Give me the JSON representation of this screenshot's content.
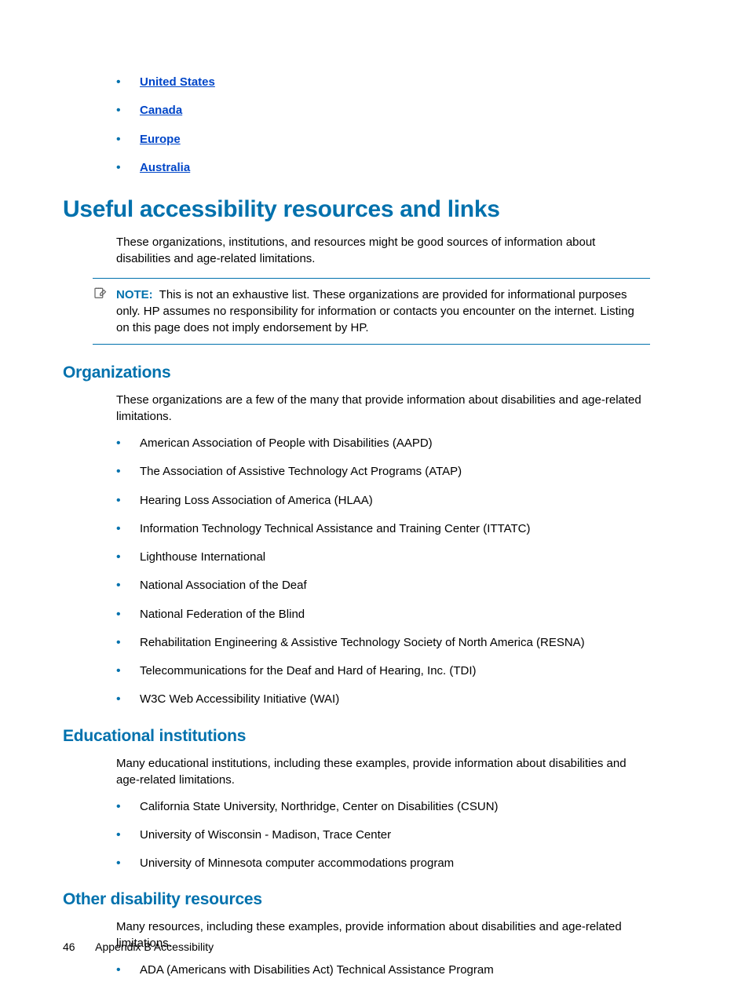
{
  "top_links": [
    "United States",
    "Canada",
    "Europe",
    "Australia"
  ],
  "h1": "Useful accessibility resources and links",
  "intro_para": "These organizations, institutions, and resources might be good sources of information about disabilities and age-related limitations.",
  "note": {
    "label": "NOTE:",
    "text": "This is not an exhaustive list. These organizations are provided for informational purposes only. HP assumes no responsibility for information or contacts you encounter on the internet. Listing on this page does not imply endorsement by HP."
  },
  "sections": {
    "orgs": {
      "heading": "Organizations",
      "para": "These organizations are a few of the many that provide information about disabilities and age-related limitations.",
      "items": [
        "American Association of People with Disabilities (AAPD)",
        "The Association of Assistive Technology Act Programs (ATAP)",
        "Hearing Loss Association of America (HLAA)",
        "Information Technology Technical Assistance and Training Center (ITTATC)",
        "Lighthouse International",
        "National Association of the Deaf",
        "National Federation of the Blind",
        "Rehabilitation Engineering & Assistive Technology Society of North America (RESNA)",
        "Telecommunications for the Deaf and Hard of Hearing, Inc. (TDI)",
        "W3C Web Accessibility Initiative (WAI)"
      ]
    },
    "edu": {
      "heading": "Educational institutions",
      "para": "Many educational institutions, including these examples, provide information about disabilities and age-related limitations.",
      "items": [
        "California State University, Northridge, Center on Disabilities (CSUN)",
        "University of Wisconsin - Madison, Trace Center",
        "University of Minnesota computer accommodations program"
      ]
    },
    "other": {
      "heading": "Other disability resources",
      "para": "Many resources, including these examples, provide information about disabilities and age-related limitations.",
      "items": [
        "ADA (Americans with Disabilities Act) Technical Assistance Program"
      ]
    }
  },
  "footer": {
    "page_number": "46",
    "label": "Appendix B   Accessibility"
  }
}
